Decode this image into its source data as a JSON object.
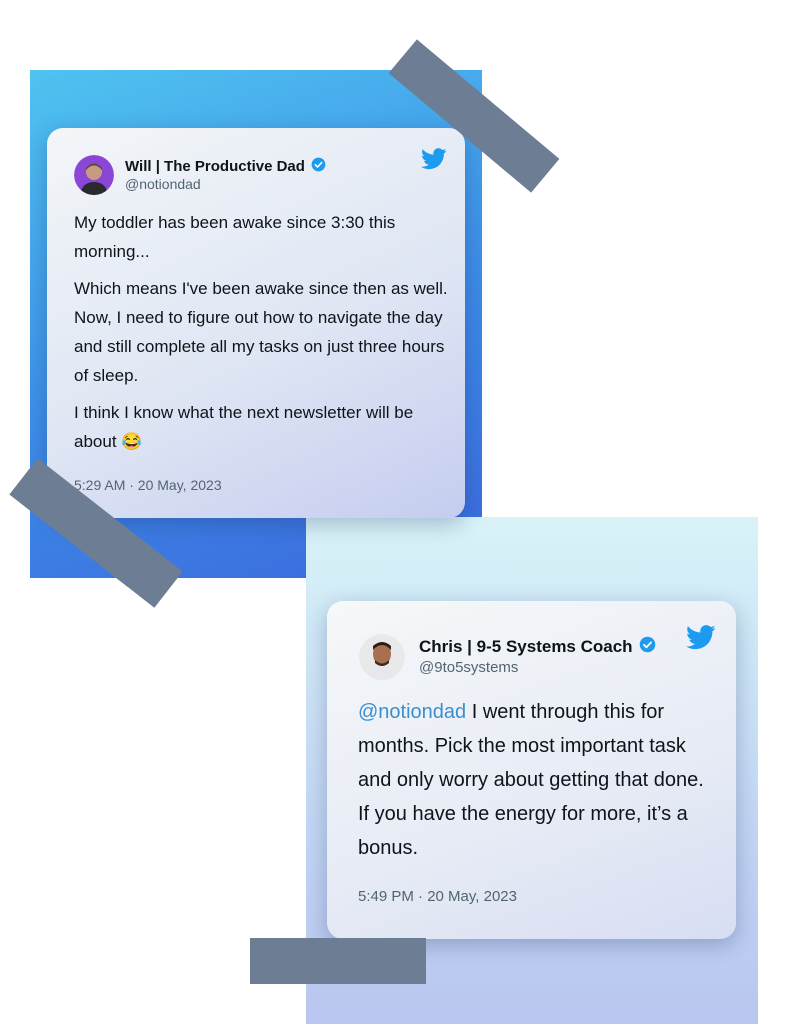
{
  "tweet1": {
    "author_name": "Will | The Productive Dad",
    "handle": "@notiondad",
    "paragraphs": [
      "My toddler has been awake since 3:30 this morning...",
      "Which means I've been awake since then as well. Now, I need to figure out how to navigate the day and still complete all my tasks on just three hours of sleep.",
      "I think I know what the next newsletter will be about"
    ],
    "emoji": "😂",
    "timestamp": "5:29 AM · 20 May, 2023"
  },
  "tweet2": {
    "author_name": "Chris | 9-5 Systems Coach",
    "handle": "@9to5systems",
    "mention": "@notiondad",
    "body": " I went through this for months. Pick the most important task and only worry about getting that done. If you have the energy for more, it’s a bonus.",
    "timestamp": "5:49 PM · 20 May, 2023"
  },
  "icons": {
    "verified": "verified-badge-icon",
    "platform": "twitter-bird-icon"
  },
  "colors": {
    "twitter_blue": "#1d9bf0",
    "mention": "#3b8fd0",
    "tape": "#6d7d93",
    "text": "#0f1419",
    "muted": "#536471"
  }
}
